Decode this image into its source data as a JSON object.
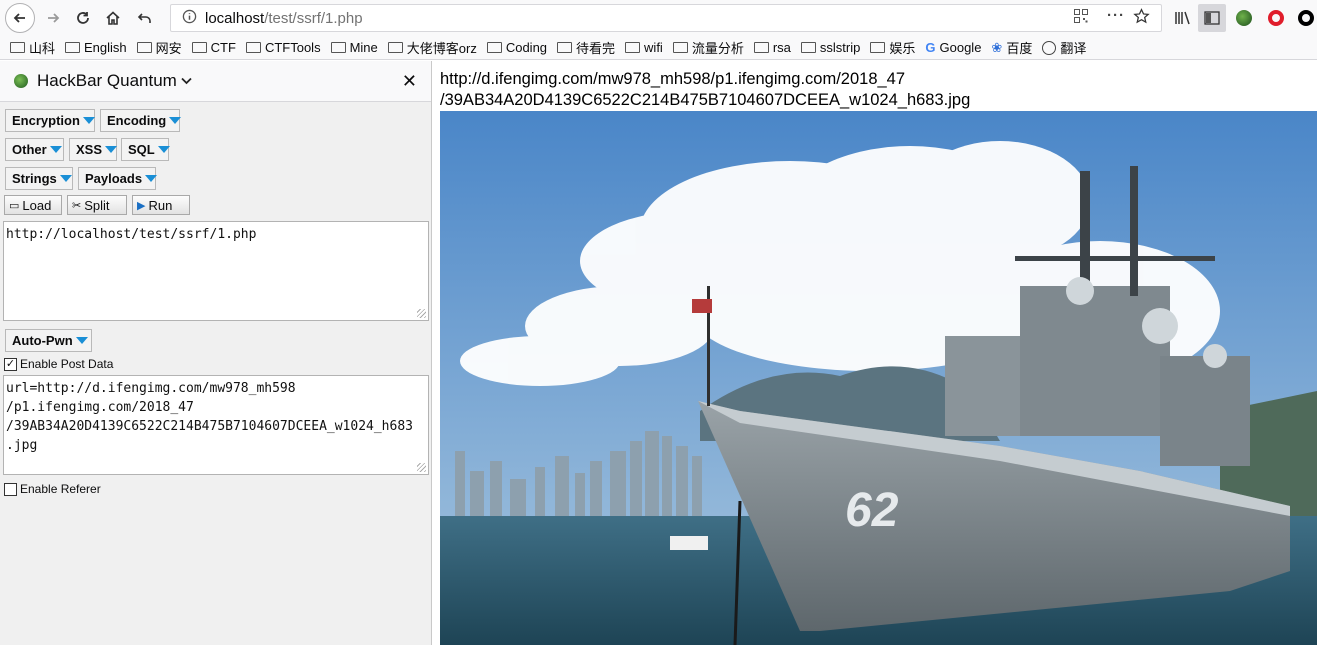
{
  "nav": {
    "url_host": "localhost",
    "url_path": "/test/ssrf/1.php",
    "icons": [
      "back-icon",
      "forward-icon",
      "reload-icon",
      "home-icon",
      "undo-icon",
      "info-icon",
      "qr-icon",
      "more-icon",
      "star-icon",
      "library-icon",
      "sidebar-icon",
      "hackbar-icon",
      "opera-icon",
      "circle-icon"
    ]
  },
  "bookmarks": [
    "山科",
    "English",
    "网安",
    "CTF",
    "CTFTools",
    "Mine",
    "大佬博客orz",
    "Coding",
    "待看完",
    "wifi",
    "流量分析",
    "rsa",
    "sslstrip",
    "娱乐",
    "Google",
    "百度",
    "翻译"
  ],
  "hackbar": {
    "title": "HackBar Quantum",
    "close": "✕",
    "menus": {
      "encryption": "Encryption",
      "encoding": "Encoding",
      "other": "Other",
      "xss": "XSS",
      "sql": "SQL",
      "strings": "Strings",
      "payloads": "Payloads"
    },
    "buttons": {
      "load": "Load",
      "split": "Split",
      "run": "Run"
    },
    "url_value": "http://localhost/test/ssrf/1.php",
    "autopwn": "Auto-Pwn",
    "enable_post": "Enable Post Data",
    "post_checked": true,
    "post_value": "url=http://d.ifengimg.com/mw978_mh598\n/p1.ifengimg.com/2018_47\n/39AB34A20D4139C6522C214B475B7104607DCEEA_w1024_h683\n.jpg",
    "enable_referer": "Enable Referer",
    "referer_checked": false
  },
  "content": {
    "line1": "http://d.ifengimg.com/mw978_mh598/p1.ifengimg.com/2018_47",
    "line2": "/39AB34A20D4139C6522C214B475B7104607DCEEA_w1024_h683.jpg",
    "hull_number": "62"
  }
}
